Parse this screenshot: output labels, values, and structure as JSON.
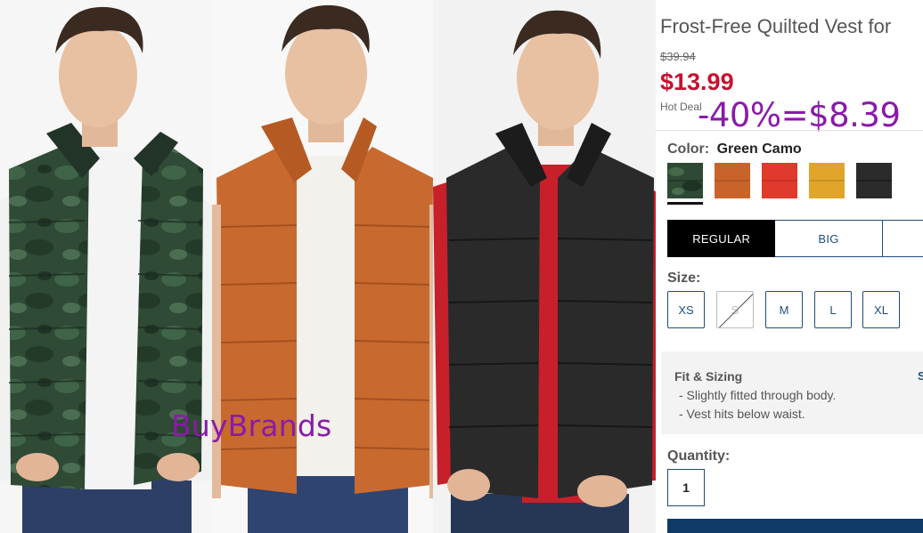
{
  "watermark": "BuyBrands",
  "product": {
    "title": "Frost-Free Quilted Vest for",
    "original_price": "$39.94",
    "sale_price": "$13.99",
    "deal_label": "Hot Deal",
    "discount_overlay": "-40%=$8.39",
    "sale_color": "#c8102e",
    "overlay_color": "#8a1aa8"
  },
  "color": {
    "label": "Color:",
    "selected": "Green Camo",
    "swatches": [
      {
        "name": "Green Camo",
        "hex": "#2e4a34",
        "selected": true
      },
      {
        "name": "Orange",
        "hex": "#c8642a",
        "selected": false
      },
      {
        "name": "Red",
        "hex": "#e03a2c",
        "selected": false
      },
      {
        "name": "Gold",
        "hex": "#e0a52a",
        "selected": false
      },
      {
        "name": "Black",
        "hex": "#2b2b2b",
        "selected": false
      }
    ]
  },
  "fit_tabs": [
    "REGULAR",
    "BIG",
    ""
  ],
  "size": {
    "label": "Size:",
    "options": [
      {
        "label": "XS",
        "available": true
      },
      {
        "label": "S",
        "available": false
      },
      {
        "label": "M",
        "available": true
      },
      {
        "label": "L",
        "available": true
      },
      {
        "label": "XL",
        "available": true
      }
    ]
  },
  "fit_sizing": {
    "title": "Fit & Sizing",
    "more": "S",
    "lines": [
      "- Slightly fitted through body.",
      "- Vest hits below waist."
    ]
  },
  "quantity": {
    "label": "Quantity:",
    "value": "1"
  },
  "accent": "#1e4e7a"
}
